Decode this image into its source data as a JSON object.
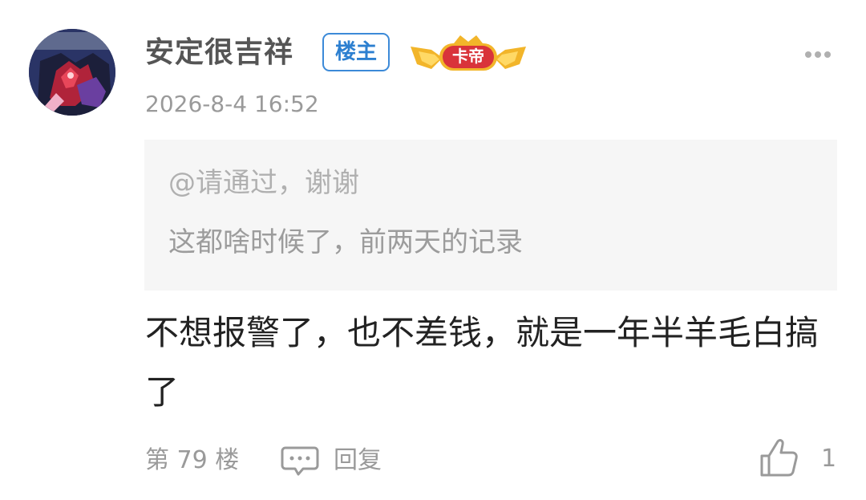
{
  "post": {
    "username": "安定很吉祥",
    "owner_badge": "楼主",
    "level_badge": "卡帝",
    "timestamp": "2026-8-4 16:52",
    "quote": {
      "user": "@请通过，谢谢",
      "text": "这都啥时候了，前两天的记录"
    },
    "content": "不想报警了，也不差钱，就是一年半羊毛白搞了",
    "floor": "第 79 楼",
    "reply_label": "回复",
    "like_count": "1"
  },
  "icons": {
    "more": "more-dots-icon",
    "reply": "comment-bubble-icon",
    "like": "thumbs-up-icon"
  },
  "colors": {
    "owner_badge": "#2c7fd0",
    "level_badge": "#d9333a",
    "level_badge_gold": "#f2b52a",
    "quote_background": "#f6f6f6",
    "secondary_text": "#9a9a9a"
  }
}
